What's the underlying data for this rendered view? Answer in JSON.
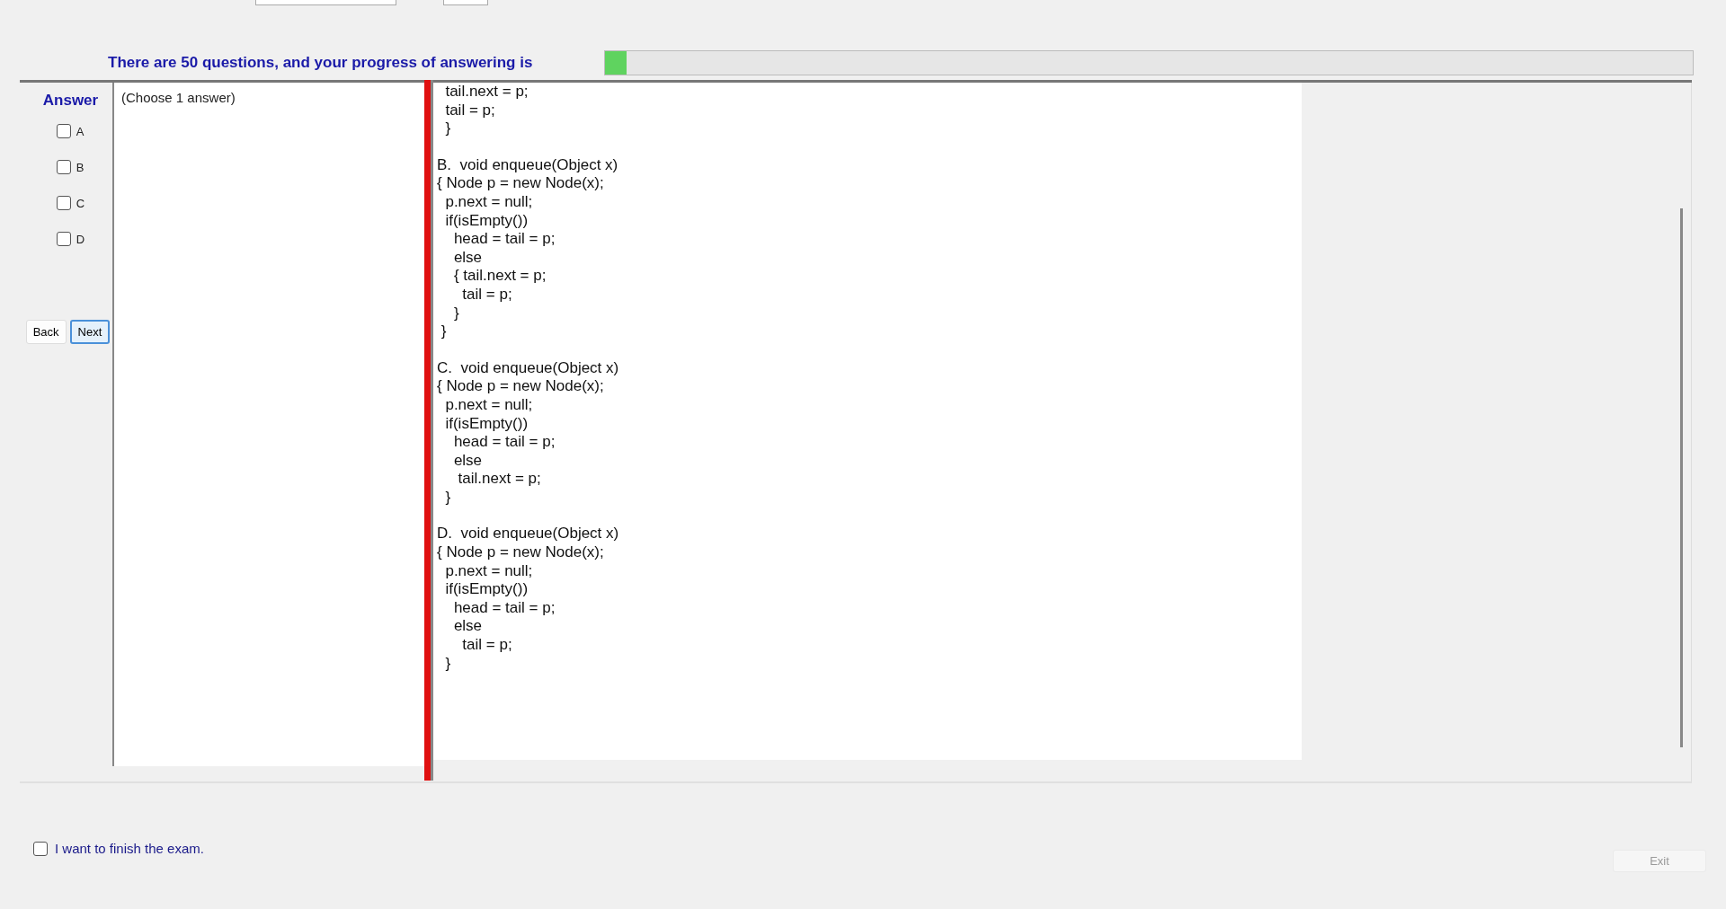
{
  "progress": {
    "label": "There are 50 questions, and your progress of answering is",
    "level": 0.02
  },
  "answer": {
    "title": "Answer",
    "options": [
      {
        "label": "A",
        "checked": false
      },
      {
        "label": "B",
        "checked": false
      },
      {
        "label": "C",
        "checked": false
      },
      {
        "label": "D",
        "checked": false
      }
    ]
  },
  "nav_buttons": [
    {
      "label": "Back",
      "focused": false
    },
    {
      "label": "Next",
      "focused": true
    }
  ],
  "question": {
    "hint": "(Choose 1 answer)",
    "code_blocks": [
      [
        "  tail.next = p;",
        "  tail = p;",
        "  }"
      ],
      [
        "B.  void enqueue(Object x)",
        "{ Node p = new Node(x);",
        "  p.next = null;",
        "  if(isEmpty())",
        "    head = tail = p;",
        "    else",
        "    { tail.next = p;",
        "      tail = p;",
        "    }",
        " }"
      ],
      [
        "C.  void enqueue(Object x)",
        "{ Node p = new Node(x);",
        "  p.next = null;",
        "  if(isEmpty())",
        "    head = tail = p;",
        "    else",
        "     tail.next = p;",
        "  }"
      ],
      [
        "D.  void enqueue(Object x)",
        "{ Node p = new Node(x);",
        "  p.next = null;",
        "  if(isEmpty())",
        "    head = tail = p;",
        "    else",
        "      tail = p;",
        "  }"
      ]
    ]
  },
  "finish": {
    "label": "I want to finish the exam.",
    "checked": false
  },
  "exit_button": {
    "label": "Exit",
    "disabled": true
  }
}
